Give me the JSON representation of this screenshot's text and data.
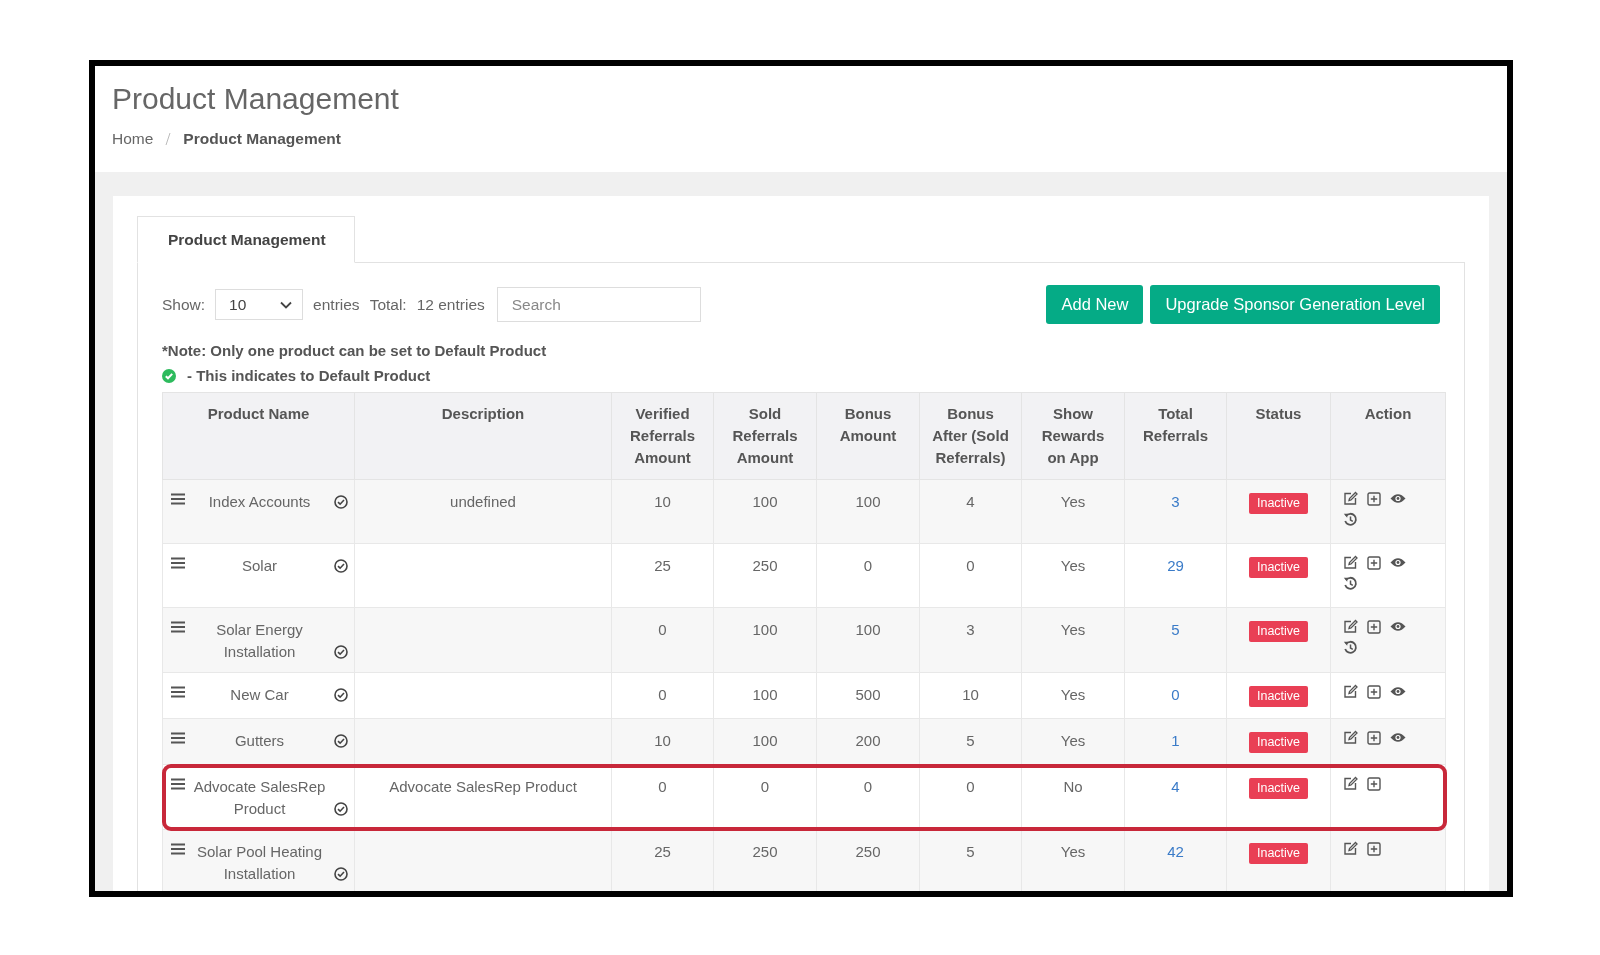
{
  "page": {
    "title": "Product Management",
    "breadcrumb": [
      {
        "label": "Home",
        "current": false
      },
      {
        "label": "Product Management",
        "current": true
      }
    ]
  },
  "tabs": [
    {
      "label": "Product Management",
      "selected": true
    }
  ],
  "controls": {
    "show_label": "Show:",
    "page_size": "10",
    "entries_label": "entries",
    "total_label": "Total:",
    "total_value": "12 entries",
    "search": {
      "placeholder": "Search"
    }
  },
  "buttons": [
    "Add New",
    "Upgrade Sponsor Generation Level"
  ],
  "note": "*Note: Only one product can be set to Default Product",
  "legend": "- This indicates to Default Product",
  "table": {
    "columns": [
      "Product Name",
      "Description",
      "Verified Referrals Amount",
      "Sold Referrals Amount",
      "Bonus Amount",
      "Bonus After (Sold Referrals)",
      "Show Rewards on App",
      "Total Referrals",
      "Status",
      "Action"
    ],
    "rows": [
      {
        "name": "Index Accounts",
        "default": false,
        "description": "undefined",
        "verified": "10",
        "sold": "100",
        "bonus": "100",
        "bonus_after": "4",
        "show_rewards": "Yes",
        "total": "3",
        "status": "Inactive",
        "highlighted": false,
        "actions": [
          {
            "kind": "edit"
          },
          {
            "kind": "add"
          },
          {
            "kind": "view"
          },
          {
            "kind": "history"
          }
        ]
      },
      {
        "name": "Solar",
        "default": false,
        "description": "",
        "verified": "25",
        "sold": "250",
        "bonus": "0",
        "bonus_after": "0",
        "show_rewards": "Yes",
        "total": "29",
        "status": "Inactive",
        "highlighted": false,
        "actions": [
          {
            "kind": "edit"
          },
          {
            "kind": "add"
          },
          {
            "kind": "view"
          },
          {
            "kind": "history"
          }
        ]
      },
      {
        "name": "Solar Energy Installation",
        "default": false,
        "description": "",
        "verified": "0",
        "sold": "100",
        "bonus": "100",
        "bonus_after": "3",
        "show_rewards": "Yes",
        "total": "5",
        "status": "Inactive",
        "highlighted": false,
        "actions": [
          {
            "kind": "edit"
          },
          {
            "kind": "add"
          },
          {
            "kind": "view"
          },
          {
            "kind": "history"
          }
        ]
      },
      {
        "name": "New Car",
        "default": false,
        "description": "",
        "verified": "0",
        "sold": "100",
        "bonus": "500",
        "bonus_after": "10",
        "show_rewards": "Yes",
        "total": "0",
        "status": "Inactive",
        "highlighted": false,
        "actions": [
          {
            "kind": "edit"
          },
          {
            "kind": "add"
          },
          {
            "kind": "view"
          }
        ]
      },
      {
        "name": "Gutters",
        "default": false,
        "description": "",
        "verified": "10",
        "sold": "100",
        "bonus": "200",
        "bonus_after": "5",
        "show_rewards": "Yes",
        "total": "1",
        "status": "Inactive",
        "highlighted": false,
        "actions": [
          {
            "kind": "edit"
          },
          {
            "kind": "add"
          },
          {
            "kind": "view"
          }
        ]
      },
      {
        "name": "Advocate SalesRep Product",
        "default": false,
        "description": "Advocate SalesRep Product",
        "verified": "0",
        "sold": "0",
        "bonus": "0",
        "bonus_after": "0",
        "show_rewards": "No",
        "total": "4",
        "status": "Inactive",
        "highlighted": true,
        "actions": [
          {
            "kind": "edit"
          },
          {
            "kind": "add"
          }
        ]
      },
      {
        "name": "Solar Pool Heating Installation",
        "default": false,
        "description": "",
        "verified": "25",
        "sold": "250",
        "bonus": "250",
        "bonus_after": "5",
        "show_rewards": "Yes",
        "total": "42",
        "status": "Inactive",
        "highlighted": false,
        "actions": [
          {
            "kind": "edit"
          },
          {
            "kind": "add"
          }
        ]
      }
    ]
  }
}
